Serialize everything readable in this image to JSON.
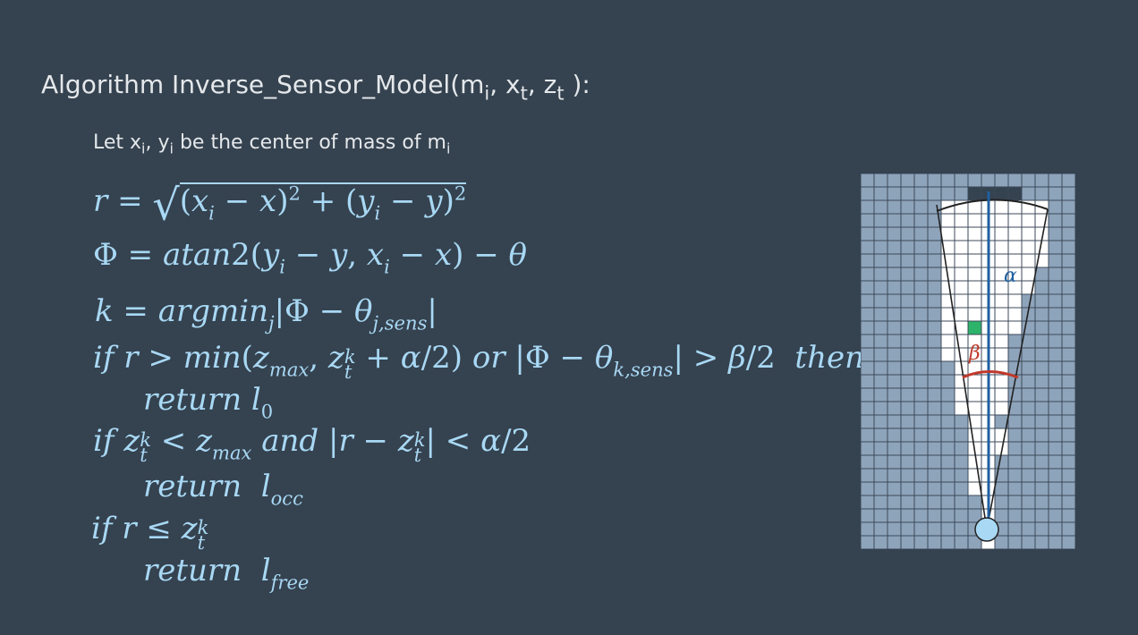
{
  "slide": {
    "title_prefix": "Algorithm Inverse_Sensor_Model(m",
    "title_arg1_sub": "i",
    "title_sep1": ", x",
    "title_arg2_sub": "t",
    "title_sep2": ", z",
    "title_arg3_sub": "t",
    "title_suffix": " ):",
    "let_prefix": "Let x",
    "let_x_sub": "i",
    "let_mid": ", y",
    "let_y_sub": "i",
    "let_rest": " be the center of mass of m",
    "let_m_sub": "i"
  },
  "diagram": {
    "alpha_label": "α",
    "beta_label": "β",
    "colors": {
      "unknown_cell": "#8ea4bb",
      "free_cell": "#ffffff",
      "occupied_cell": "#35424f",
      "highlight_cell": "#2db36a",
      "beam": "#1f5fa0",
      "arc_beta": "#c0392b",
      "robot": "#a8d8f4"
    }
  },
  "colors": {
    "background": "#35424f",
    "title_text": "#e4e8eb",
    "math_text": "#a8d8f4"
  }
}
